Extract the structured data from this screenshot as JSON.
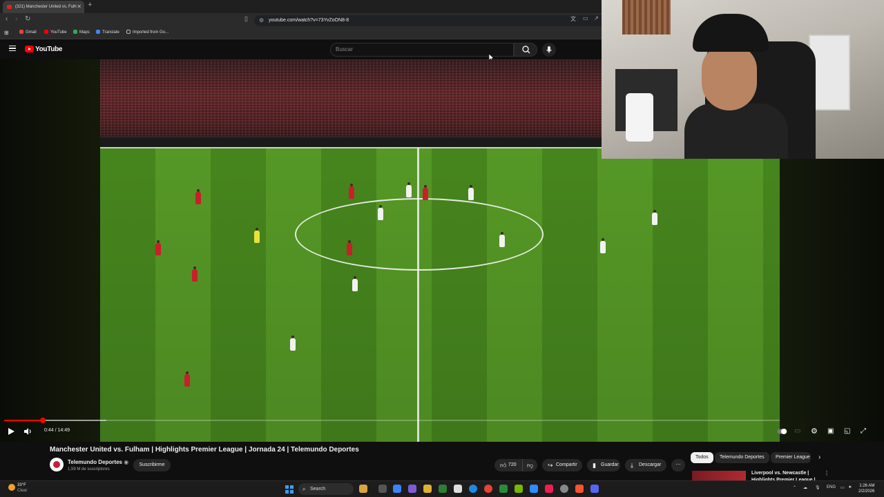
{
  "browser": {
    "tab_title": "(321) Manchester United vs. Fulh",
    "new_tab_symbol": "+",
    "url": "youtube.com/watch?v=73YvZoON8-8",
    "bookmarks": [
      "Gmail",
      "YouTube",
      "Maps",
      "Translate",
      "Imported from Go..."
    ]
  },
  "youtube": {
    "logo_text": "YouTube",
    "search_placeholder": "Buscar"
  },
  "player": {
    "time": "0:44 / 14:49",
    "progress": 0.0495
  },
  "video": {
    "title": "Manchester United vs. Fulham | Highlights Premier League | Jornada 24 | Telemundo Deportes",
    "channel": "Telemundo Deportes",
    "subscribers": "1,59 M de suscriptores",
    "subscribe_label": "Suscribirme",
    "likes": "720",
    "share_label": "Compartir",
    "save_label": "Guardar",
    "download_label": "Descargar"
  },
  "sidebar": {
    "chips": [
      "Todos",
      "Telemundo Deportes",
      "Premier League"
    ],
    "rec_title_1": "Liverpool vs. Newcastle |",
    "rec_title_2": "Highlights Premier League |"
  },
  "taskbar": {
    "temp": "33°F",
    "weather": "Clear",
    "search_label": "Search",
    "lang": "ENG",
    "time": "1:26 AM",
    "date": "2/2/2026"
  },
  "colors": {
    "accent": "#ff0000",
    "background": "#0f0f0f",
    "pitch_green": "#5aa028"
  }
}
